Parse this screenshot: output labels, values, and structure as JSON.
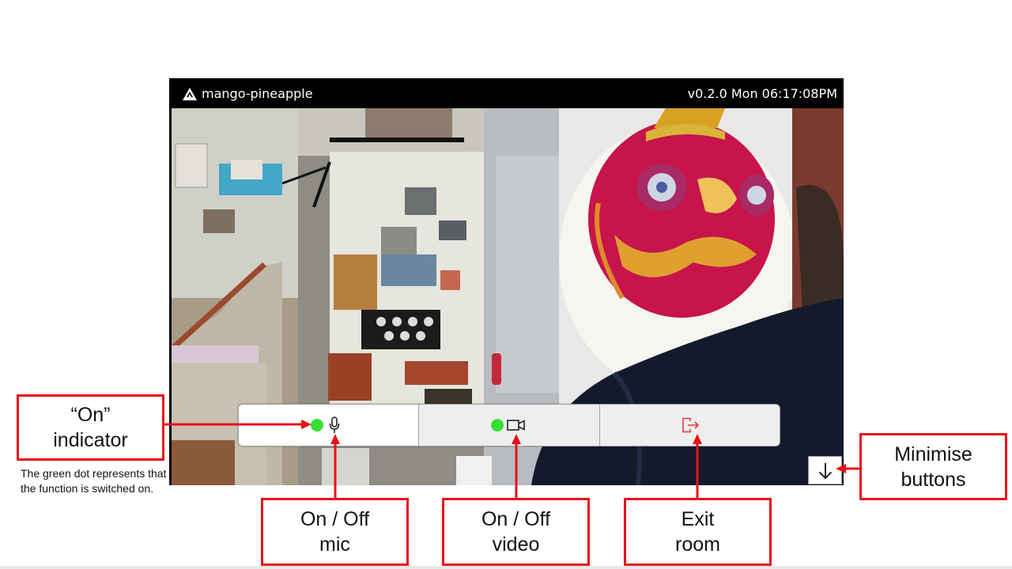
{
  "window": {
    "app_name": "mango-pineapple",
    "status": "v0.2.0 Mon 06:17:08PM"
  },
  "controls": {
    "mic": {
      "icon": "microphone-icon",
      "state_icon": "green-dot-indicator",
      "on": true
    },
    "video": {
      "icon": "video-camera-icon",
      "state_icon": "green-dot-indicator",
      "on": true
    },
    "exit": {
      "icon": "exit-door-icon"
    },
    "minimise": {
      "icon": "arrow-down-icon"
    }
  },
  "annotations": {
    "on_indicator": "“On”\nindicator",
    "on_indicator_note": "The green dot represents that the function is switched on.",
    "mic": "On / Off\nmic",
    "video": "On / Off\nvideo",
    "exit": "Exit\nroom",
    "minimise": "Minimise\nbuttons"
  },
  "colors": {
    "indicator_green": "#33e033",
    "annotation_red": "#e8101a",
    "exit_red": "#e53935",
    "titlebar": "#000000"
  }
}
